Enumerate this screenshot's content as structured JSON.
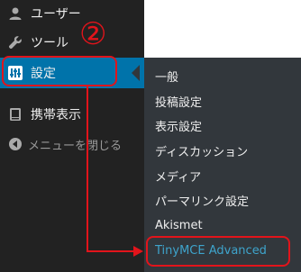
{
  "sidebar": {
    "items": [
      {
        "key": "users",
        "label": "ユーザー",
        "icon": "user-icon"
      },
      {
        "key": "tools",
        "label": "ツール",
        "icon": "wrench-icon"
      },
      {
        "key": "settings",
        "label": "設定",
        "icon": "settings-sliders-icon",
        "active": true
      },
      {
        "key": "mobile",
        "label": "携帯表示",
        "icon": "mobile-display-icon"
      }
    ],
    "collapse_label": "メニューを閉じる"
  },
  "submenu": {
    "items": [
      {
        "label": "一般"
      },
      {
        "label": "投稿設定"
      },
      {
        "label": "表示設定"
      },
      {
        "label": "ディスカッション"
      },
      {
        "label": "メディア"
      },
      {
        "label": "パーマリンク設定"
      },
      {
        "label": "Akismet"
      },
      {
        "label": "TinyMCE Advanced",
        "highlighted": true
      }
    ]
  },
  "annotation": {
    "step_number": "②",
    "color": "#e2141b"
  },
  "colors": {
    "sidebar_bg": "#222222",
    "submenu_bg": "#32373c",
    "active_bg": "#0073aa",
    "link_highlight": "#3ea4cc"
  }
}
